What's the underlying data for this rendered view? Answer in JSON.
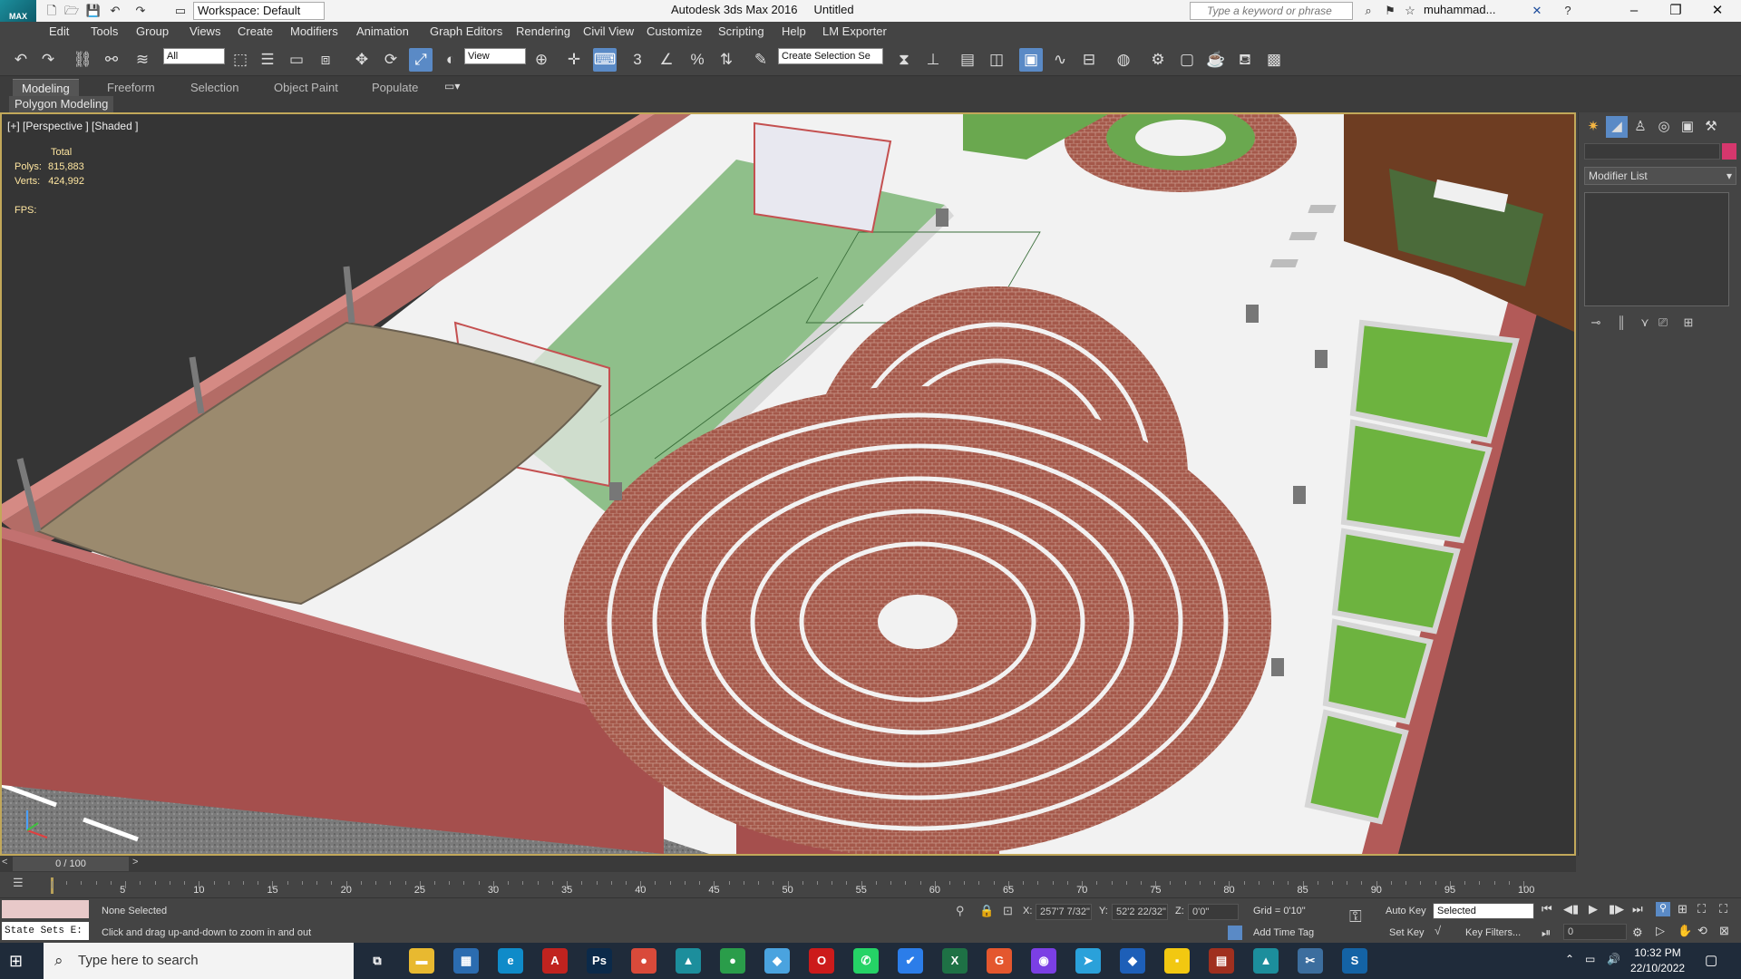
{
  "titlebar": {
    "logo": "MAX",
    "workspace": "Workspace: Default",
    "app_name": "Autodesk 3ds Max 2016",
    "doc_name": "Untitled",
    "search_placeholder": "Type a keyword or phrase",
    "user": "muhammad..."
  },
  "menu": [
    "Edit",
    "Tools",
    "Group",
    "Views",
    "Create",
    "Modifiers",
    "Animation",
    "Graph Editors",
    "Rendering",
    "Civil View",
    "Customize",
    "Scripting",
    "Help",
    "LM Exporter"
  ],
  "toolbar": {
    "selection_filter": "All",
    "ref_coord": "View",
    "named_selection": "Create Selection Se",
    "snaps_label": "3",
    "percent_label": "%"
  },
  "ribbon": {
    "tabs": [
      "Modeling",
      "Freeform",
      "Selection",
      "Object Paint",
      "Populate"
    ],
    "panel": "Polygon Modeling"
  },
  "viewport": {
    "label": "[+] [Perspective ] [Shaded ]",
    "stats": {
      "total_label": "Total",
      "polys_label": "Polys:",
      "polys_value": "815,883",
      "verts_label": "Verts:",
      "verts_value": "424,992",
      "fps_label": "FPS:"
    }
  },
  "command_panel": {
    "modifier_list": "Modifier List",
    "color": "#d6376d"
  },
  "timeline": {
    "frame": "0 / 100",
    "ticks": [
      "5",
      "10",
      "15",
      "20",
      "25",
      "30",
      "35",
      "40",
      "45",
      "50",
      "55",
      "60",
      "65",
      "70",
      "75",
      "80",
      "85",
      "90",
      "95",
      "100"
    ]
  },
  "status": {
    "state_sets": "State Sets E:",
    "selection": "None Selected",
    "prompt": "Click and drag up-and-down to zoom in and out",
    "x_label": "X:",
    "x_value": "257'7 7/32\"",
    "y_label": "Y:",
    "y_value": "52'2 22/32\"",
    "z_label": "Z:",
    "z_value": "0'0\"",
    "grid": "Grid = 0'10\"",
    "add_time_tag": "Add Time Tag",
    "auto_key": "Auto Key",
    "set_key": "Set Key",
    "selected_dropdown": "Selected",
    "key_filters": "Key Filters...",
    "frame_field": "0"
  },
  "taskbar": {
    "search_placeholder": "Type here to search",
    "time": "10:32 PM",
    "date": "22/10/2022",
    "apps": [
      {
        "icon": "task-view-icon",
        "label": "⧉",
        "color": "transparent"
      },
      {
        "icon": "file-explorer-icon",
        "label": "▬",
        "color": "#e8b930"
      },
      {
        "icon": "calculator-icon",
        "label": "▦",
        "color": "#2b6cb0"
      },
      {
        "icon": "edge-icon",
        "label": "e",
        "color": "#0f8bc9"
      },
      {
        "icon": "acrobat-icon",
        "label": "A",
        "color": "#c0231f"
      },
      {
        "icon": "photoshop-icon",
        "label": "Ps",
        "color": "#0b2a4a"
      },
      {
        "icon": "chrome-icon",
        "label": "●",
        "color": "#d94a3a"
      },
      {
        "icon": "3dsmax-icon",
        "label": "▲",
        "color": "#1c8e9c"
      },
      {
        "icon": "chrome-alt-icon",
        "label": "●",
        "color": "#2a9d4a"
      },
      {
        "icon": "app-blue-icon",
        "label": "◆",
        "color": "#4aa3df"
      },
      {
        "icon": "opera-icon",
        "label": "O",
        "color": "#cc1b1b"
      },
      {
        "icon": "whatsapp-icon",
        "label": "✆",
        "color": "#25d366"
      },
      {
        "icon": "todo-icon",
        "label": "✔",
        "color": "#2b7de9"
      },
      {
        "icon": "excel-icon",
        "label": "X",
        "color": "#1e7145"
      },
      {
        "icon": "grammarly-icon",
        "label": "G",
        "color": "#e4572e"
      },
      {
        "icon": "podcast-icon",
        "label": "◉",
        "color": "#7b3fe4"
      },
      {
        "icon": "telegram-icon",
        "label": "➤",
        "color": "#2aa1da"
      },
      {
        "icon": "cube-icon",
        "label": "◆",
        "color": "#1d5fb8"
      },
      {
        "icon": "sticky-notes-icon",
        "label": "▪",
        "color": "#f2c811"
      },
      {
        "icon": "winrar-icon",
        "label": "▤",
        "color": "#a0301f"
      },
      {
        "icon": "3dsmax-active-icon",
        "label": "▲",
        "color": "#1c8e9c"
      },
      {
        "icon": "snipping-icon",
        "label": "✂",
        "color": "#3c6e9e"
      },
      {
        "icon": "sketchup-icon",
        "label": "S",
        "color": "#1463a5"
      }
    ]
  }
}
